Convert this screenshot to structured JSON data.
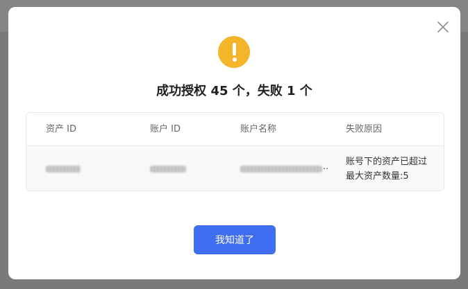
{
  "dialog": {
    "close_icon": "close-icon",
    "status_icon": "warning-icon",
    "status_color": "#f5b52a",
    "title": "成功授权 45 个，失败 1 个",
    "table": {
      "columns": [
        "资产 ID",
        "账户 ID",
        "账户名称",
        "失败原因"
      ],
      "rows": [
        {
          "asset_id": "",
          "account_id": "",
          "account_name_suffix": "..",
          "reason": "账号下的资产已超过\n最大资产数量:5"
        }
      ]
    },
    "confirm_button": {
      "label": "我知道了",
      "color": "#3f6ef0"
    }
  }
}
